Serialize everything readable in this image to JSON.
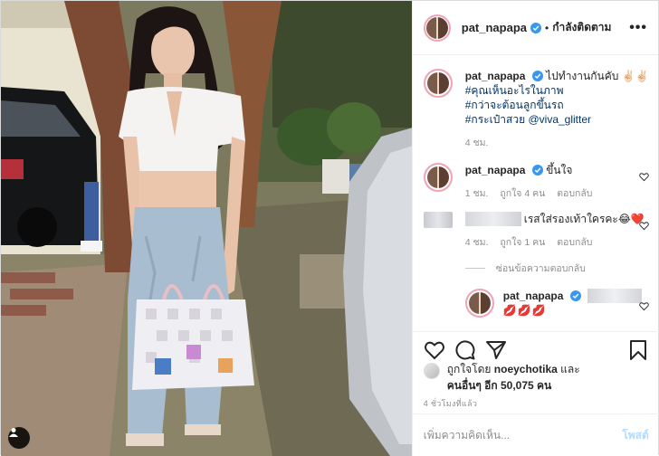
{
  "header": {
    "username": "pat_napapa",
    "separator": "•",
    "follow_status": "กำลังติดตาม",
    "more_label": "•••"
  },
  "caption": {
    "username": "pat_napapa",
    "text": "ไปทำงานกันคับ ✌🏻✌🏻",
    "tags": [
      "#คุณเห็นอะไรในภาพ",
      "#กว่าจะต้อนลูกขึ้นรถ",
      "#กระเป๋าสวย"
    ],
    "mention": "@viva_glitter",
    "time": "4 ชม."
  },
  "comments": [
    {
      "username": "pat_napapa",
      "text": "ขึ้นใจ",
      "time": "1 ชม.",
      "likes": "ถูกใจ 4 คน",
      "reply": "ตอบกลับ"
    },
    {
      "username": "",
      "text": "เรสใส่รองเท้าใครคะ😂❤️",
      "time": "4 ชม.",
      "likes": "ถูกใจ 1 คน",
      "reply": "ตอบกลับ"
    }
  ],
  "view_replies": "ซ่อนข้อความตอบกลับ",
  "reply": {
    "username": "pat_napapa",
    "text": "💋💋💋"
  },
  "likes": {
    "prefix": "ถูกใจโดย",
    "user": "noeychotika",
    "and": "และ",
    "others": "คนอื่นๆ อีก 50,075 คน"
  },
  "timestamp": "4 ชั่วโมงที่แล้ว",
  "add_comment": {
    "placeholder": "เพิ่มความคิดเห็น...",
    "post_label": "โพสต์"
  },
  "colors": {
    "link": "#003569",
    "verified": "#3897f0",
    "post_disabled": "#b3dbff"
  },
  "icons": [
    "heart-icon",
    "comment-icon",
    "share-icon",
    "bookmark-icon",
    "user-tag-icon",
    "verified-icon",
    "more-icon"
  ]
}
